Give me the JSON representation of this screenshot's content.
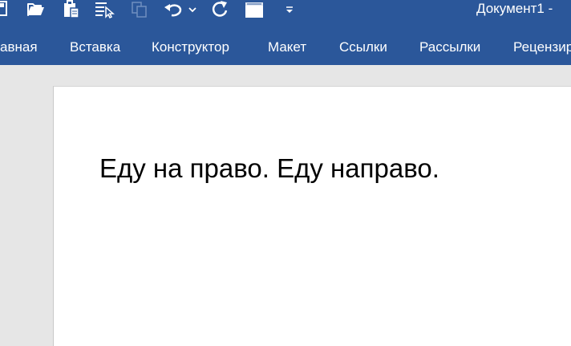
{
  "window": {
    "title": "Документ1  -  "
  },
  "quick_access": {
    "icons": [
      "save-icon",
      "open-folder-icon",
      "clipboard-icon",
      "selection-pane-icon",
      "copy-icon",
      "undo-icon",
      "dropdown-chevron-icon",
      "redo-icon",
      "screenshot-icon",
      "customize-toolbar-icon"
    ]
  },
  "ribbon": {
    "tabs": [
      {
        "label": "авная"
      },
      {
        "label": "Вставка"
      },
      {
        "label": "Конструктор"
      },
      {
        "label": "Макет"
      },
      {
        "label": "Ссылки"
      },
      {
        "label": "Рассылки"
      },
      {
        "label": "Рецензирование"
      }
    ]
  },
  "document": {
    "text": "Еду на право. Еду направо."
  },
  "colors": {
    "ribbon_bg": "#2b579a",
    "canvas_bg": "#e6e6e6",
    "page_bg": "#ffffff",
    "text": "#000000"
  }
}
